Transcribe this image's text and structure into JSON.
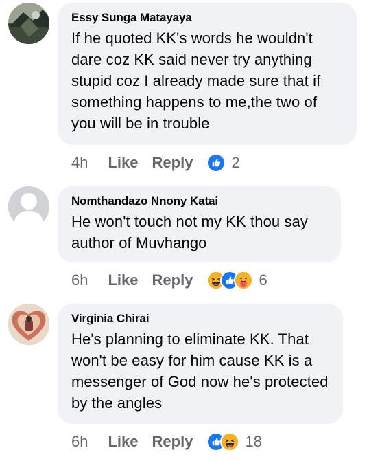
{
  "comments": [
    {
      "author": "Essy Sunga Matayaya",
      "text": "If he quoted KK's words he wouldn't dare coz KK said never try anything stupid coz I already made sure that if something happens to me,the two of you will be in trouble",
      "time": "4h",
      "like_label": "Like",
      "reply_label": "Reply",
      "reactions": [
        "like-reaction-icon"
      ],
      "reaction_count": "2"
    },
    {
      "author": "Nomthandazo Nnony Katai",
      "text": "He won't touch not my KK thou say author of Muvhango",
      "time": "6h",
      "like_label": "Like",
      "reply_label": "Reply",
      "reactions": [
        "haha-reaction-icon",
        "like-reaction-icon",
        "care-reaction-icon"
      ],
      "reaction_count": "6"
    },
    {
      "author": "Virginia Chirai",
      "text": "He's planning to eliminate KK. That won't be easy for him cause KK is a messenger of God now he's protected by the angles",
      "time": "6h",
      "like_label": "Like",
      "reply_label": "Reply",
      "reactions": [
        "like-reaction-icon",
        "haha-reaction-icon"
      ],
      "reaction_count": "18"
    }
  ],
  "colors": {
    "bubble": "#f0f2f5",
    "meta_text": "#65676b",
    "like_blue": "#1877f2",
    "reaction_yellow": "#f7b125"
  }
}
